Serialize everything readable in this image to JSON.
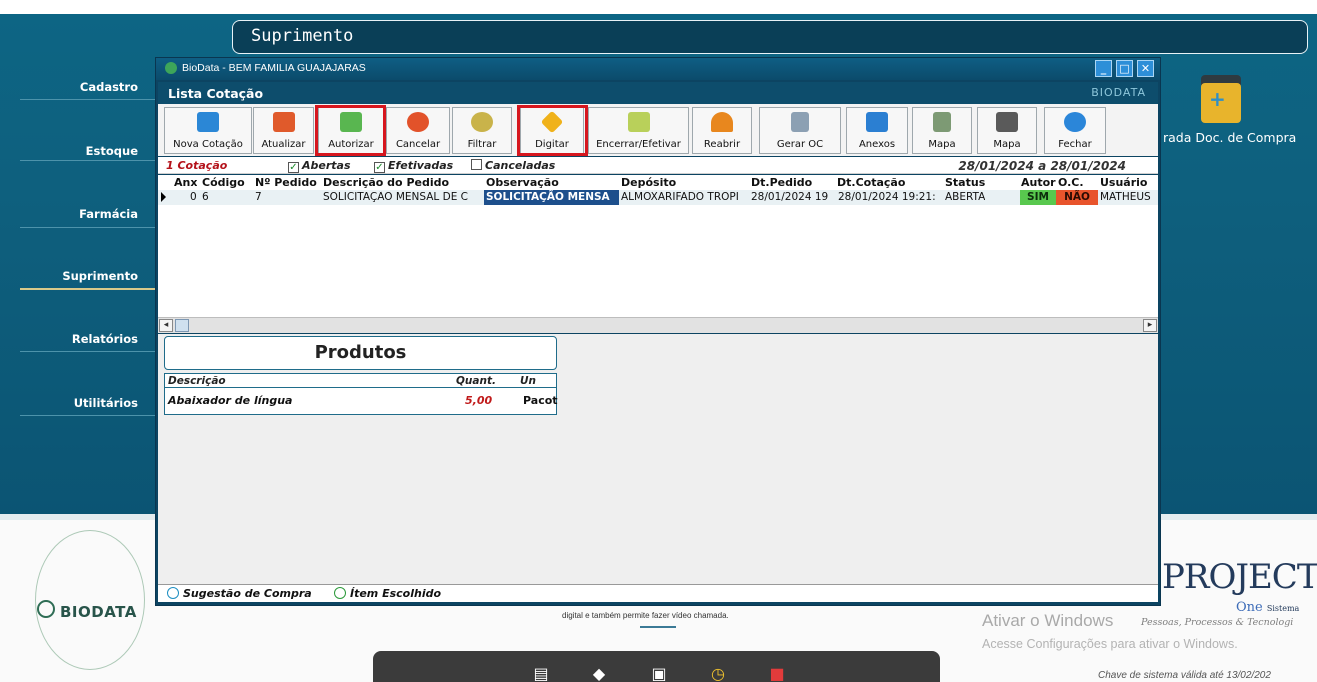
{
  "app": {
    "header_title": "Suprimento"
  },
  "sidebar": {
    "items": [
      {
        "label": "Cadastro"
      },
      {
        "label": "Estoque"
      },
      {
        "label": "Farmácia"
      },
      {
        "label": "Suprimento"
      },
      {
        "label": "Relatórios"
      },
      {
        "label": "Utilitários"
      }
    ]
  },
  "desktop": {
    "shortcut_label": "rada Doc. de Compra",
    "brand_left": "BIODATA",
    "brand_right": "PROJECT",
    "brand_right_sub": "One",
    "brand_right_sub_small": "Sistema",
    "activation_title": "Ativar o Windows",
    "activation_tagline": "Pessoas, Processos & Tecnologi",
    "activation_hint": "Acesse Configurações para ativar o Windows.",
    "key_notice": "Chave de sistema válida até 13/02/202",
    "center_text": "digital e também permite fazer vídeo chamada."
  },
  "window": {
    "title": "BioData - BEM FAMILIA GUAJAJARAS",
    "section_title": "Lista Cotação",
    "brand": "BIODATA",
    "toolbar": [
      {
        "label": "Nova Cotação",
        "icon": "add-arrow-icon",
        "color": "#2b87d6"
      },
      {
        "label": "Atualizar",
        "icon": "refresh-icon",
        "color": "#e05a2b"
      },
      {
        "label": "Autorizar",
        "icon": "check-icon",
        "color": "#59b650"
      },
      {
        "label": "Cancelar",
        "icon": "cancel-icon",
        "color": "#e2522a"
      },
      {
        "label": "Filtrar",
        "icon": "magnifier-icon",
        "color": "#c9b34a"
      },
      {
        "label": "Digitar",
        "icon": "sign-icon",
        "color": "#f0b21a"
      },
      {
        "label": "Encerrar/Efetivar",
        "icon": "checkbox-icon",
        "color": "#b9d05a"
      },
      {
        "label": "Reabrir",
        "icon": "undo-arrow-icon",
        "color": "#e8871e"
      },
      {
        "label": "Gerar OC",
        "icon": "document-icon",
        "color": "#8ca0b3"
      },
      {
        "label": "Anexos",
        "icon": "attach-icon",
        "color": "#2b7fd2"
      },
      {
        "label": "Mapa",
        "icon": "sheet-icon",
        "color": "#7d9a74"
      },
      {
        "label": "Mapa",
        "icon": "printer-icon",
        "color": "#5a5a5a"
      },
      {
        "label": "Fechar",
        "icon": "power-icon",
        "color": "#2b86d9"
      }
    ],
    "filter": {
      "count": "1 Cotação",
      "options": [
        {
          "label": "Abertas",
          "checked": true
        },
        {
          "label": "Efetivadas",
          "checked": true
        },
        {
          "label": "Canceladas",
          "checked": false
        }
      ],
      "date_from": "28/01/2024",
      "date_sep": "a",
      "date_to": "28/01/2024"
    },
    "grid": {
      "columns": [
        "Anx",
        "Código",
        "Nº Pedido",
        "Descrição do Pedido",
        "Observação",
        "Depósito",
        "Dt.Pedido",
        "Dt.Cotação",
        "Status",
        "Autor",
        "O.C.",
        "Usuário"
      ],
      "row": {
        "anx": "0",
        "codigo": "6",
        "pedido": "7",
        "descricao": "SOLICITAÇÃO MENSAL DE C",
        "observacao": "SOLICITAÇÃO MENSA",
        "deposito": "ALMOXARIFADO TROPI",
        "dt_pedido": "28/01/2024 19",
        "dt_cotacao": "28/01/2024 19:21:",
        "status": "ABERTA",
        "autor": "SIM",
        "oc": "NÃO",
        "usuario": "MATHEUS"
      }
    },
    "produtos": {
      "title": "Produtos",
      "columns": [
        "Descrição",
        "Quant.",
        "Un"
      ],
      "row": {
        "descricao": "Abaixador de língua",
        "quant": "5,00",
        "un": "Pacot"
      }
    },
    "legend": [
      {
        "label": "Sugestão de Compra"
      },
      {
        "label": "Ítem Escolhido"
      }
    ]
  }
}
